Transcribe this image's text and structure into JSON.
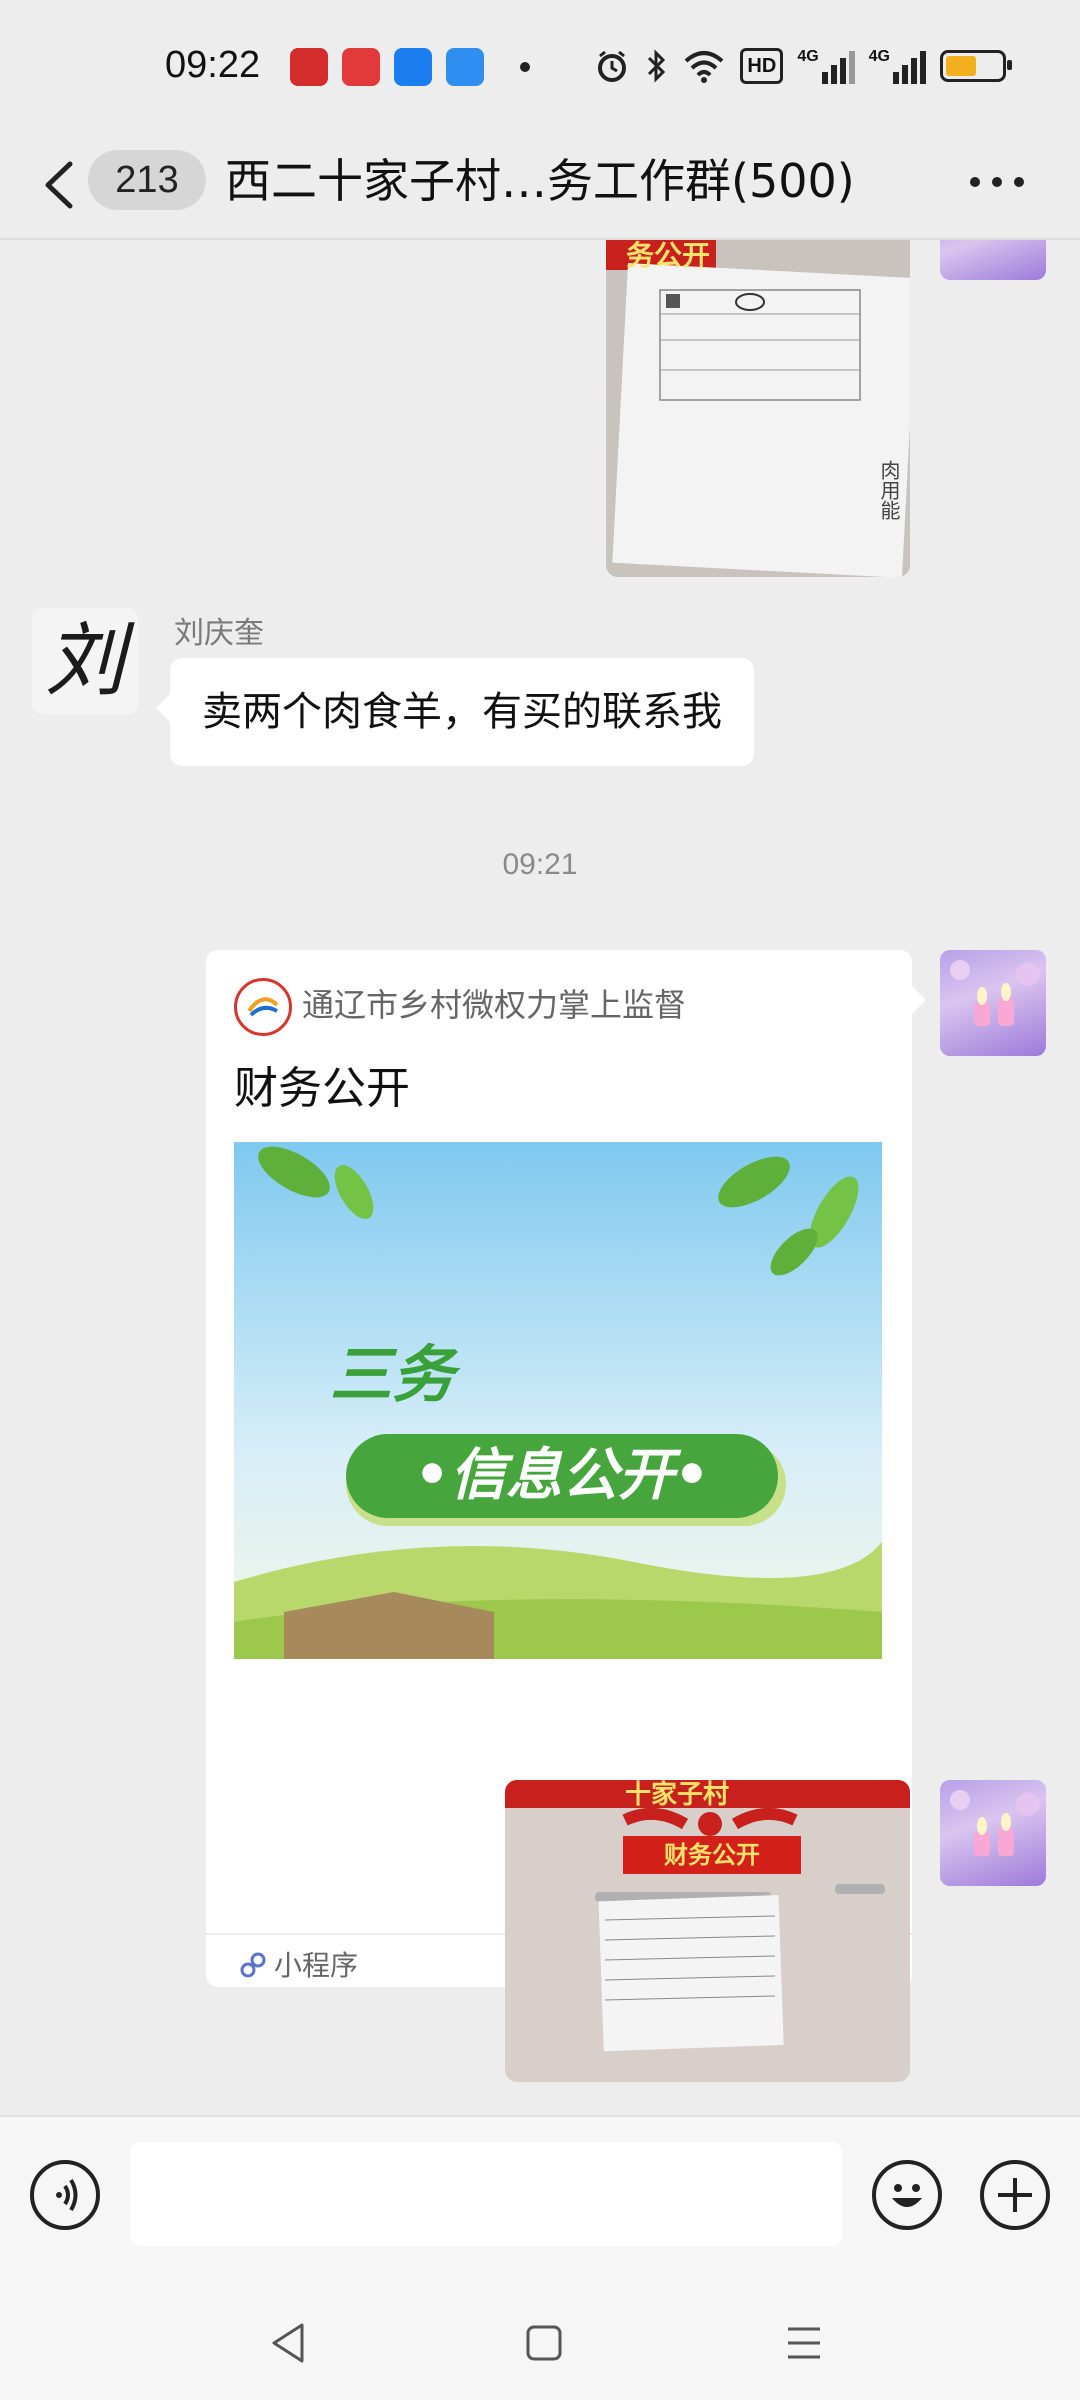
{
  "status_bar": {
    "time": "09:22",
    "app_icons": [
      "xuexi-app-icon",
      "toutiao-app-icon",
      "video-app-icon",
      "blue-app-icon"
    ],
    "app_icon_colors": [
      "#d42b2b",
      "#e23a3a",
      "#1a7ef0",
      "#2f8ff0"
    ],
    "right_icons": [
      "alarm-icon",
      "bluetooth-icon",
      "wifi-icon",
      "hd-volte-icon",
      "signal-4g-icon",
      "signal-4g-icon-2",
      "battery-icon"
    ],
    "hd_label": "HD",
    "network_label": "4G",
    "battery_level": 0.55
  },
  "header": {
    "unread_count": "213",
    "title": "西二十家子村…务工作群(500)"
  },
  "messages": {
    "image_top": {
      "banner_text": "务公开",
      "side_text": "肉用能"
    },
    "text_message": {
      "sender": "刘庆奎",
      "avatar_glyph": "刘",
      "text": "卖两个肉食羊，有买的联系我"
    },
    "timestamp": "09:21",
    "mini_program": {
      "source": "通辽市乡村微权力掌上监督",
      "title": "财务公开",
      "image_heading": "三务",
      "image_banner": "•信息公开•",
      "footer_label": "小程序"
    },
    "image_bottom": {
      "header_text": "十家子村",
      "banner_text": "财务公开"
    }
  },
  "input_bar": {
    "placeholder": ""
  },
  "colors": {
    "background": "#ededed",
    "bubble": "#ffffff",
    "accent_green": "#4caf3a",
    "red_banner": "#d32019"
  }
}
